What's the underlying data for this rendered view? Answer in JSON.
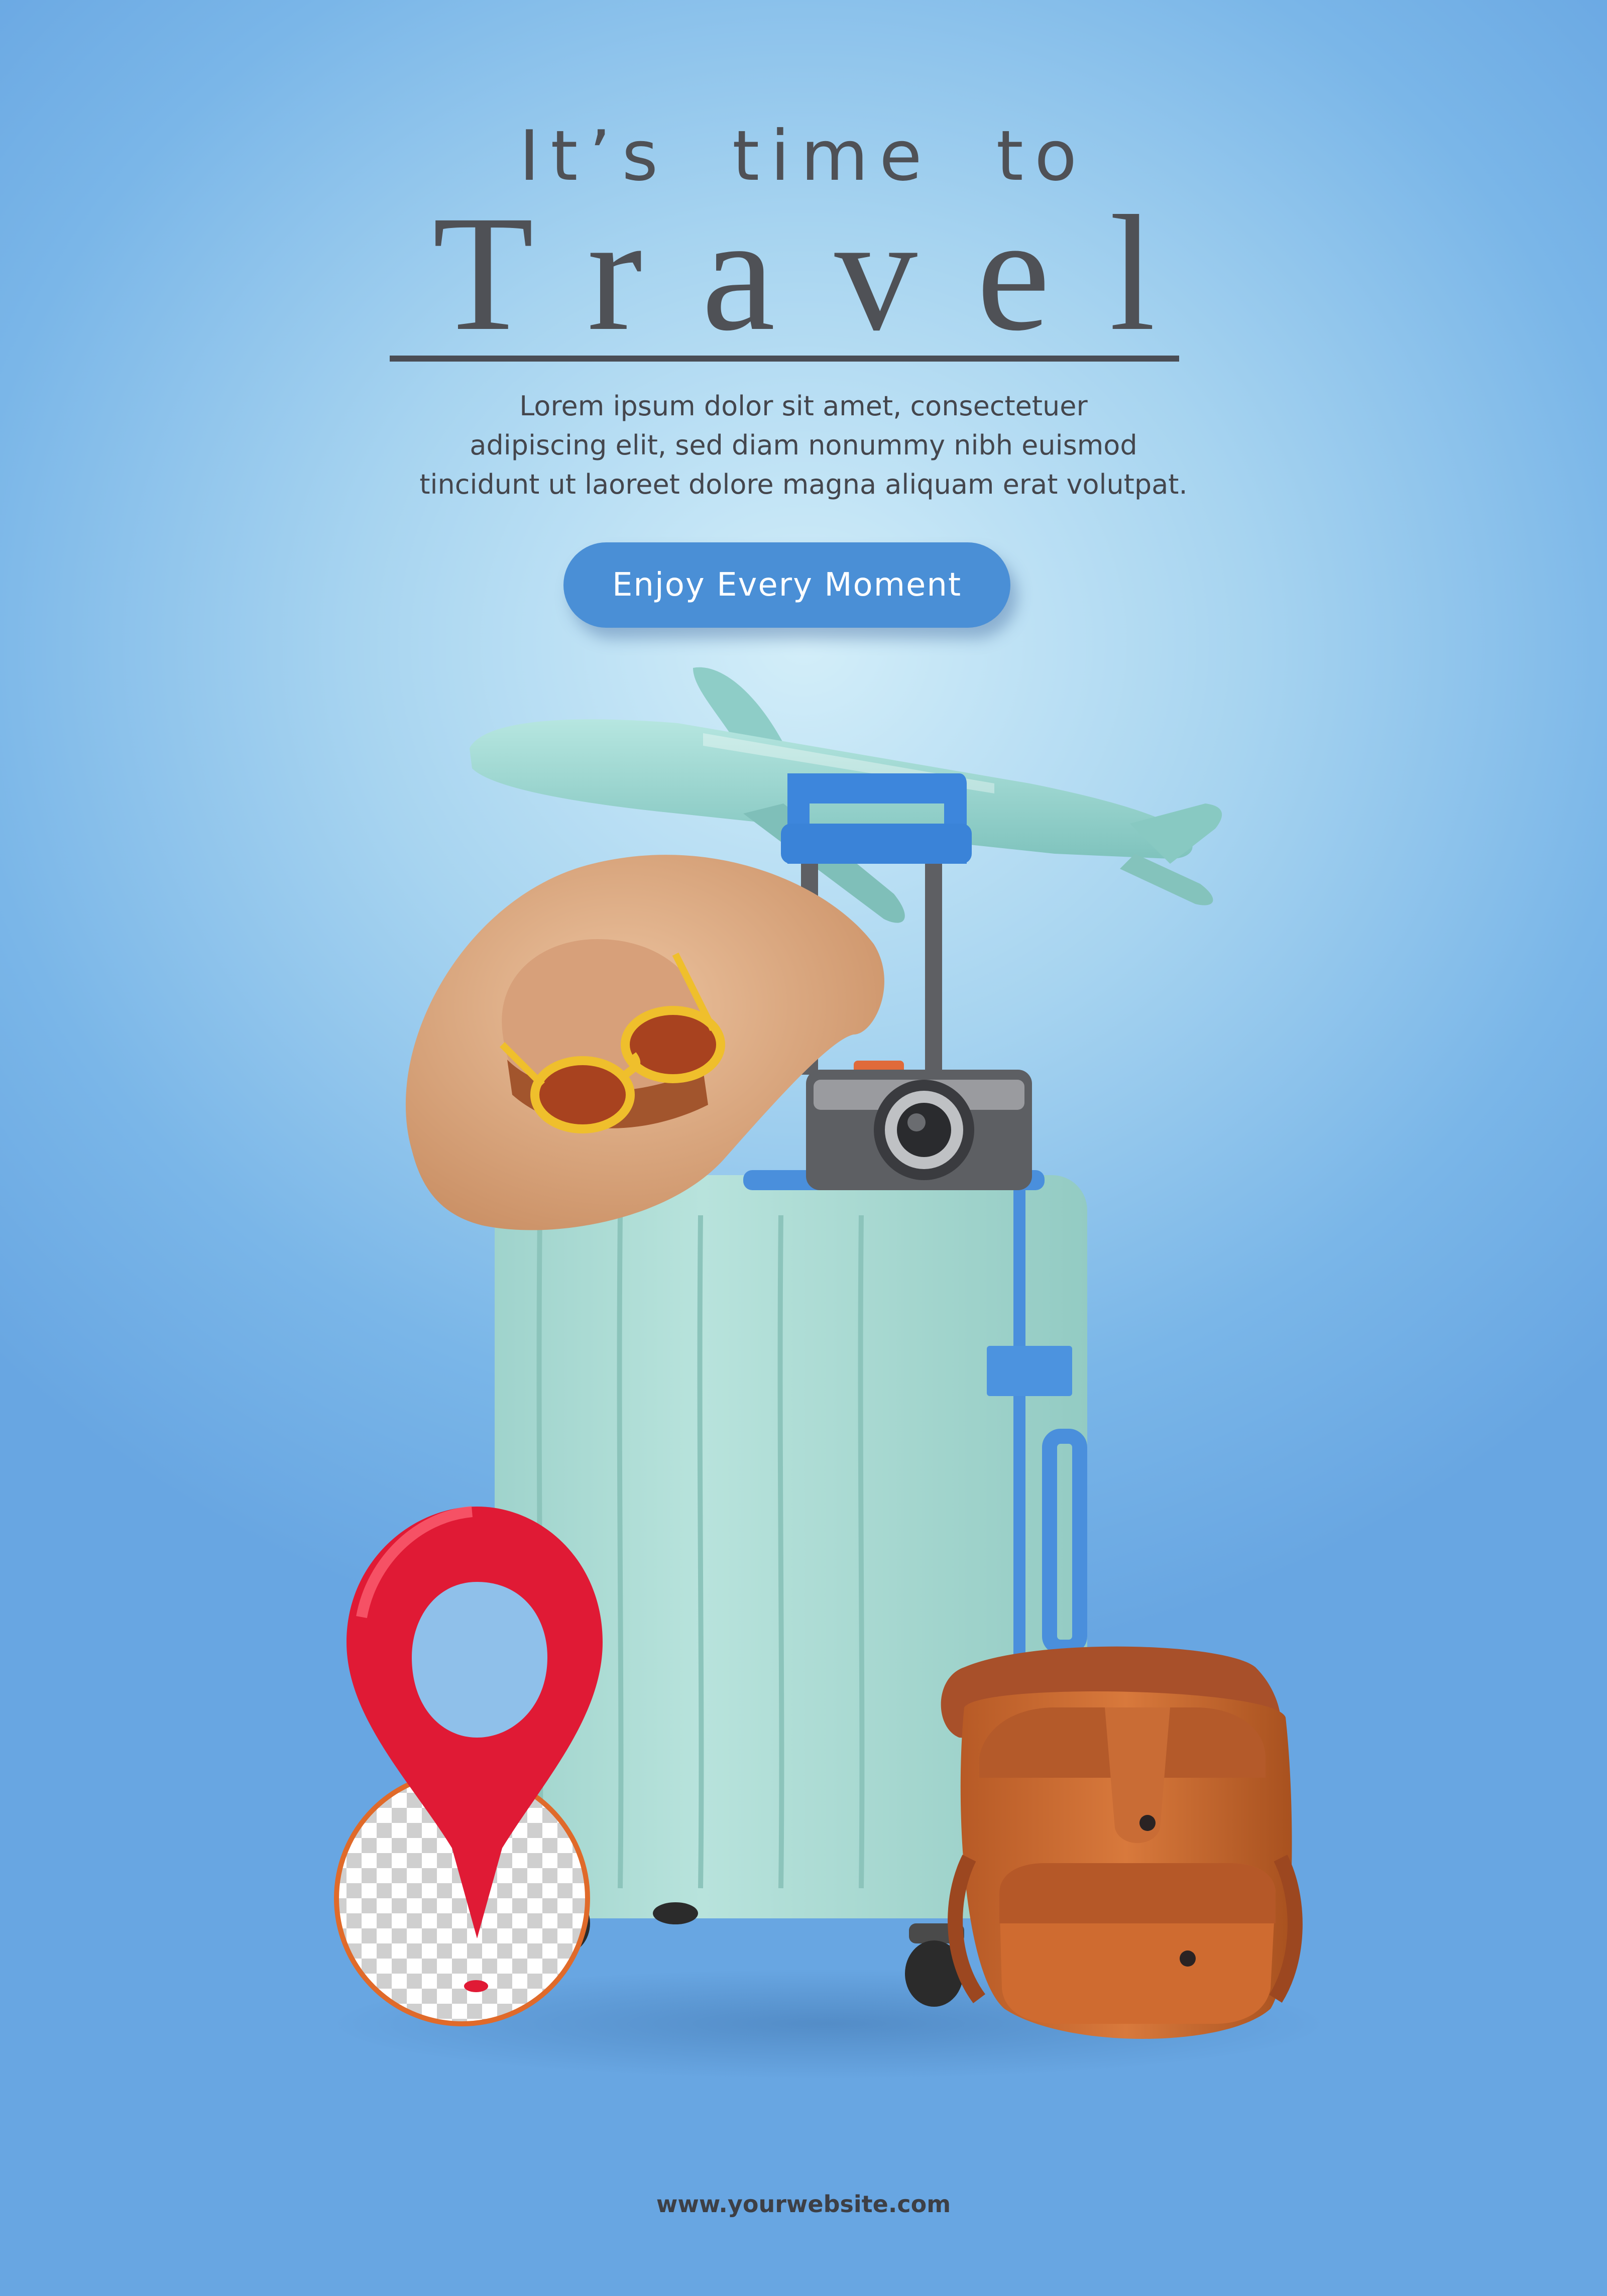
{
  "headline": {
    "line1": "It’s time to",
    "line2": "Travel"
  },
  "description": {
    "lines": [
      "Lorem ipsum dolor sit amet, consectetuer",
      "adipiscing elit, sed diam nonummy nibh euismod",
      "tincidunt ut laoreet dolore magna aliquam erat volutpat."
    ]
  },
  "cta": {
    "label": "Enjoy Every Moment"
  },
  "footer": {
    "website": "www.yourwebsite.com"
  },
  "colors": {
    "background_center": "#d3eef9",
    "background_edge": "#68a6e2",
    "text_dark": "#4f5156",
    "button": "#4a8fd6",
    "suitcase": "#a9dbd3",
    "airplane": "#96d3cf",
    "hat": "#d9a982",
    "backpack": "#c86a32",
    "location_pin": "#e01a35"
  },
  "illustration": {
    "items": [
      "airplane-icon",
      "suitcase-icon",
      "sun-hat-icon",
      "sunglasses-icon",
      "camera-icon",
      "backpack-icon",
      "location-pin-icon",
      "transparency-circle"
    ]
  }
}
